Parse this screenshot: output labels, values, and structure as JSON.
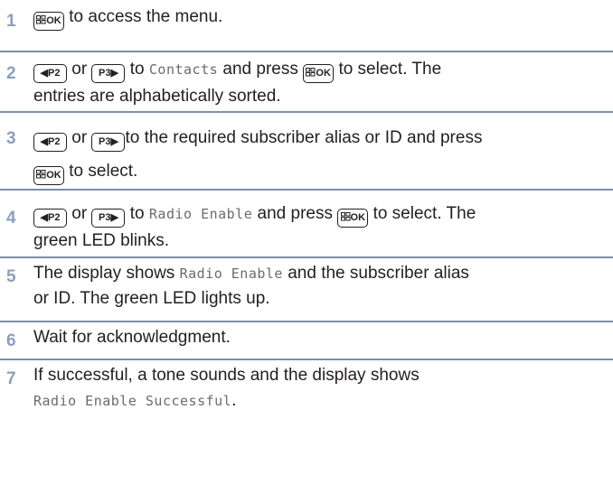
{
  "icons": {
    "menu_ok_key": "menu-ok-key-icon",
    "p2_key": "p2-left-key-icon",
    "p3_key": "p3-right-key-icon"
  },
  "keys": {
    "menu_ok": "OK",
    "p2": "P2",
    "p3": "P3"
  },
  "steps": [
    {
      "number": "1",
      "text_a": "to access the menu."
    },
    {
      "number": "2",
      "or": "or",
      "to": "to",
      "menu_item": "Contacts",
      "text_b": "and press",
      "text_c": "to select. The",
      "text_d": "entries are alphabetically sorted."
    },
    {
      "number": "3",
      "or": "or",
      "text_a": "to the required subscriber alias or ID and press",
      "text_b": "to select."
    },
    {
      "number": "4",
      "or": "or",
      "to": "to",
      "menu_item": "Radio Enable",
      "text_b": "and press",
      "text_c": "to select. The",
      "text_d": "green LED blinks."
    },
    {
      "number": "5",
      "text_a": "The display shows",
      "menu_item": "Radio Enable",
      "text_b": "and the subscriber alias",
      "text_c": "or ID. The green LED lights up."
    },
    {
      "number": "6",
      "text_a": "Wait for acknowledgment."
    },
    {
      "number": "7",
      "text_a": "If successful, a tone sounds and the display shows",
      "menu_item": "Radio Enable Successful",
      "text_b": "."
    }
  ]
}
